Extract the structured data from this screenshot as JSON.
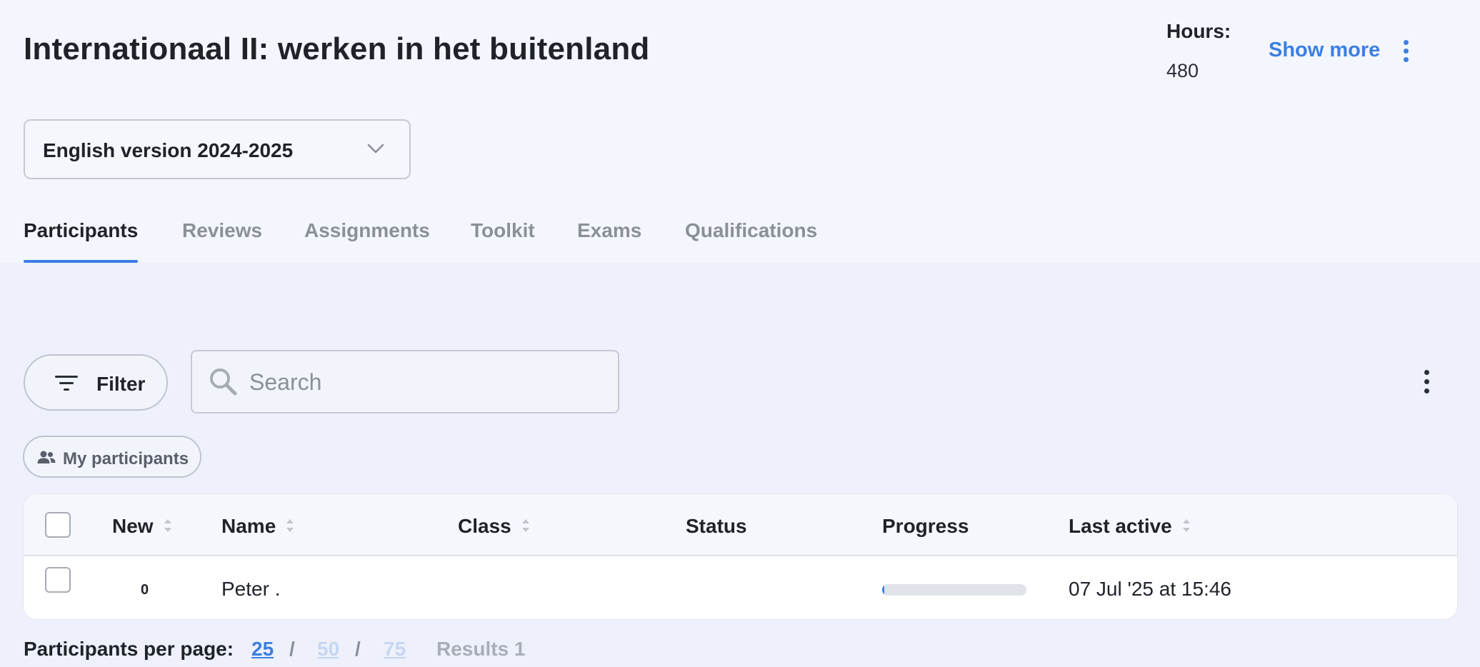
{
  "header": {
    "title": "Internationaal II: werken in het buitenland",
    "hours_label": "Hours:",
    "hours_value": "480",
    "show_more": "Show more"
  },
  "version_select": {
    "selected": "English version 2024-2025"
  },
  "tabs": [
    {
      "label": "Participants",
      "active": true
    },
    {
      "label": "Reviews",
      "active": false
    },
    {
      "label": "Assignments",
      "active": false
    },
    {
      "label": "Toolkit",
      "active": false
    },
    {
      "label": "Exams",
      "active": false
    },
    {
      "label": "Qualifications",
      "active": false
    }
  ],
  "toolbar": {
    "filter_label": "Filter",
    "search_placeholder": "Search",
    "search_value": ""
  },
  "chip": {
    "label": "My participants"
  },
  "table": {
    "columns": [
      "New",
      "Name",
      "Class",
      "Status",
      "Progress",
      "Last active"
    ],
    "rows": [
      {
        "new": "0",
        "name": "Peter .",
        "class": "",
        "status": "",
        "progress": 0.01,
        "last_active": "07 Jul '25 at 15:46"
      }
    ]
  },
  "pagination": {
    "label": "Participants per page:",
    "options": [
      "25",
      "50",
      "75"
    ],
    "selected": "25",
    "results": "Results 1"
  },
  "colors": {
    "accent": "#3b7fe3",
    "background": "#eef1fb",
    "text": "#1f2329",
    "muted": "#8b8f98"
  }
}
